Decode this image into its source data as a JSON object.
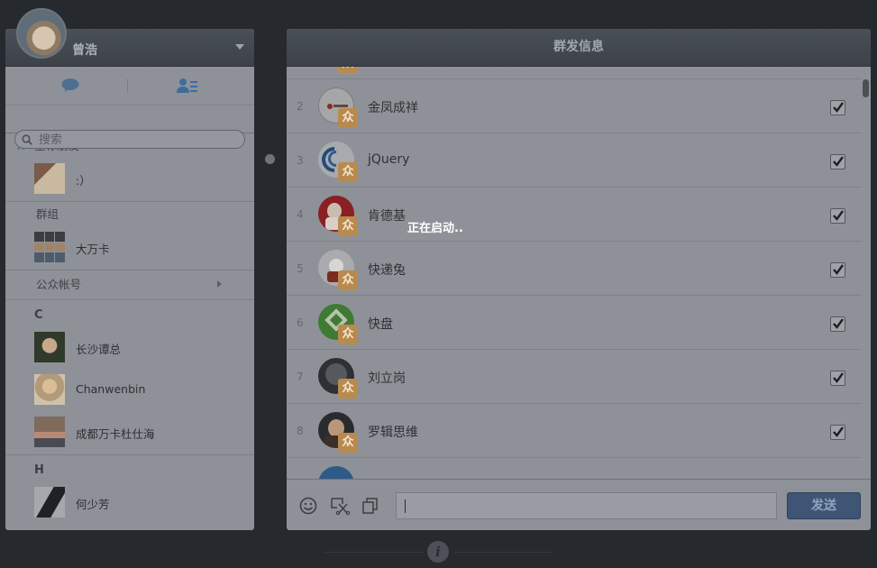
{
  "user": {
    "name": "曾浩"
  },
  "sidebar": {
    "search_placeholder": "搜索",
    "sections": {
      "starred": "星标朋友",
      "groups": "群组",
      "public": "公众帐号"
    },
    "starred_contacts": [
      ":）"
    ],
    "group_contacts": [
      "大万卡"
    ],
    "letter_c": "C",
    "letter_h": "H",
    "c_contacts": [
      "长沙谭总",
      "Chanwenbin",
      "成都万卡杜仕海"
    ],
    "h_contacts": [
      "何少芳"
    ]
  },
  "main": {
    "title": "群发信息",
    "loading_text": "正在启动..",
    "badge_glyph": "众",
    "rows": [
      {
        "num": "2",
        "name": "金凤成祥",
        "checked": true
      },
      {
        "num": "3",
        "name": "jQuery",
        "checked": true
      },
      {
        "num": "4",
        "name": "肯德基",
        "checked": true
      },
      {
        "num": "5",
        "name": "快递兔",
        "checked": true
      },
      {
        "num": "6",
        "name": "快盘",
        "checked": true
      },
      {
        "num": "7",
        "name": "刘立岗",
        "checked": true
      },
      {
        "num": "8",
        "name": "罗辑思维",
        "checked": true
      }
    ],
    "send_label": "发送",
    "message_value": ""
  },
  "icons": [
    "chat-icon",
    "contacts-icon",
    "search-icon",
    "star-icon",
    "emoji-icon",
    "screenshot-icon",
    "copy-icon",
    "info-icon"
  ],
  "colors": {
    "send_button": "#3e5576",
    "badge": "#b98a4d",
    "overlay_bg": "#8e9298"
  }
}
